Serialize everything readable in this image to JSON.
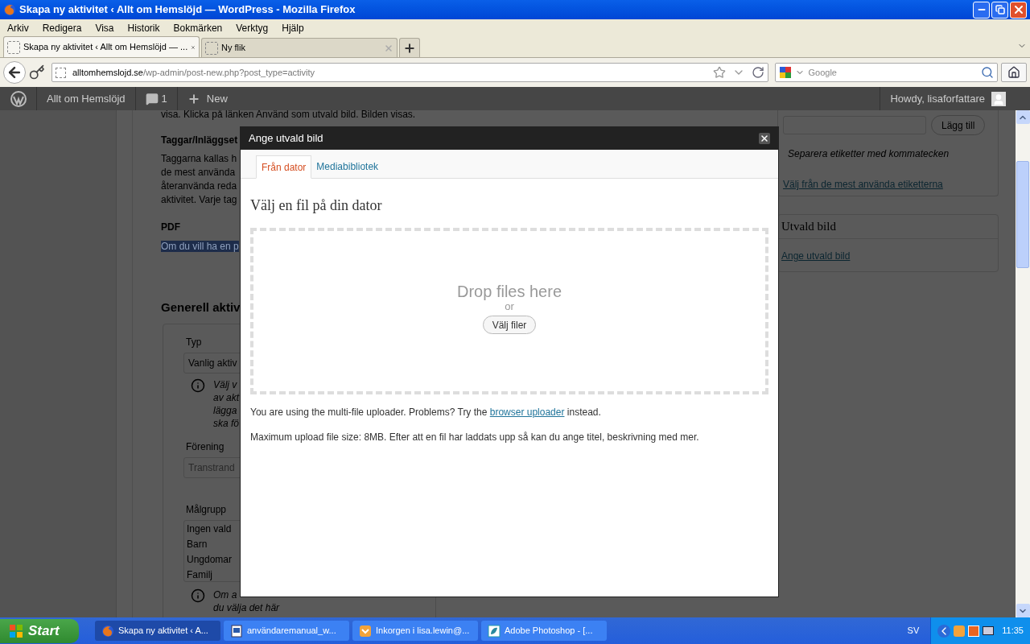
{
  "window": {
    "title": "Skapa ny aktivitet ‹ Allt om Hemslöjd — WordPress - Mozilla Firefox"
  },
  "menu": [
    "Arkiv",
    "Redigera",
    "Visa",
    "Historik",
    "Bokmärken",
    "Verktyg",
    "Hjälp"
  ],
  "tabs": [
    {
      "label": "Skapa ny aktivitet ‹ Allt om Hemslöjd — ...",
      "selected": true
    },
    {
      "label": "Ny flik",
      "selected": false
    }
  ],
  "address": {
    "host": "alltomhemslojd.se",
    "path": "/wp-admin/post-new.php?post_type=activity"
  },
  "search": {
    "placeholder": "Google"
  },
  "admin_bar": {
    "site": "Allt om Hemslöjd",
    "comments": "1",
    "new": "New",
    "greeting": "Howdy, lisaforfattare"
  },
  "page": {
    "intro": "visa. Klicka på länken Använd som utvald bild. Bilden visas.",
    "tags_heading": "Taggar/Inläggset",
    "tags_lines": [
      "Taggarna kallas h",
      "de mest använda",
      "återanvända reda",
      "aktivitet. Varje tag"
    ],
    "pdf_heading": "PDF",
    "pdf_line": "Om du vill ha en p",
    "section_heading": "Generell aktiv",
    "type_label": "Typ",
    "type_value": "Vanlig aktiv",
    "type_help": [
      "Välj v",
      "av akt",
      "lägga",
      "ska fö"
    ],
    "assoc_label": "Förening",
    "assoc_placeholder": "Transtrand",
    "audience_label": "Målgrupp",
    "audience_options": [
      "Ingen vald",
      "Barn",
      "Ungdomar",
      "Familj"
    ],
    "audience_help": [
      "Om a",
      "du välja det här"
    ]
  },
  "sidebar": {
    "add_button": "Lägg till",
    "tags_hint": "Separera etiketter med kommatecken",
    "tags_link": "Välj från de mest använda etiketterna",
    "featured_title": "Utvald bild",
    "featured_link": "Ange utvald bild"
  },
  "modal": {
    "title": "Ange utvald bild",
    "tabs": [
      {
        "label": "Från dator",
        "selected": true
      },
      {
        "label": "Mediabibliotek",
        "selected": false
      }
    ],
    "heading": "Välj en fil på din dator",
    "drop_text": "Drop files here",
    "or": "or",
    "select_button": "Välj filer",
    "uploader_before": "You are using the multi-file uploader. Problems? Try the ",
    "uploader_link": "browser uploader",
    "uploader_after": " instead.",
    "max_size": "Maximum upload file size: 8MB. Efter att en fil har laddats upp så kan du ange titel, beskrivning med mer."
  },
  "taskbar": {
    "start": "Start",
    "tasks": [
      {
        "label": "Skapa ny aktivitet ‹ A...",
        "kind": "firefox",
        "selected": true
      },
      {
        "label": "användaremanual_w...",
        "kind": "word",
        "selected": false
      },
      {
        "label": "Inkorgen i lisa.lewin@...",
        "kind": "mail",
        "selected": false
      },
      {
        "label": "Adobe Photoshop - [...",
        "kind": "photoshop",
        "selected": false
      }
    ],
    "language": "SV",
    "clock": "11:35"
  }
}
